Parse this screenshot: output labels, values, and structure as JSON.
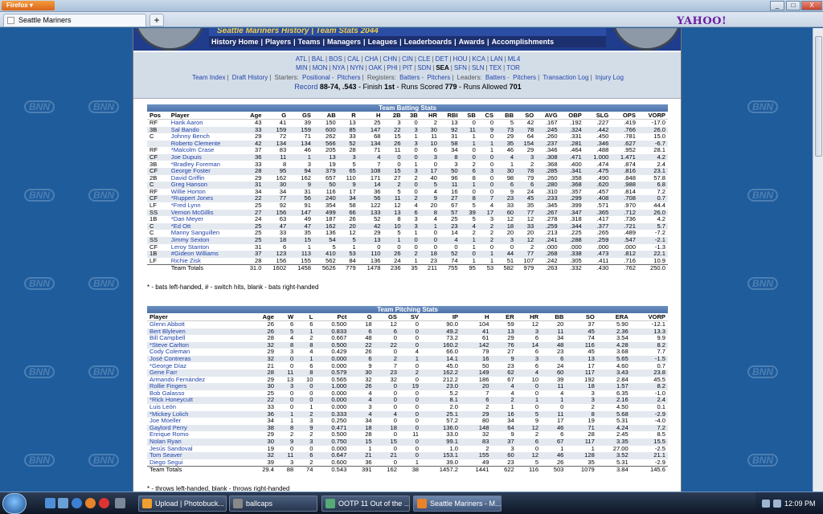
{
  "browser": {
    "app_button": "Firefox",
    "tab_title": "Seattle Mariners",
    "new_tab": "+",
    "search_brand": "YAHOO!",
    "win_min": "_",
    "win_max": "□",
    "win_close": "X"
  },
  "site": {
    "header_banner": "Seattle Mariners History | Team Stats 2044",
    "nav": [
      "History Home",
      "Players",
      "Teams",
      "Managers",
      "Leagues",
      "Leaderboards",
      "Awards",
      "Accomplishments"
    ],
    "bg_logo": "BNN"
  },
  "team_links": {
    "row1": [
      "ATL",
      "BAL",
      "BOS",
      "CAL",
      "CHA",
      "CHN",
      "CIN",
      "CLE",
      "DET",
      "HOU",
      "KCA",
      "LAN",
      "ML4"
    ],
    "row2": [
      "MIN",
      "MON",
      "NYA",
      "NYN",
      "OAK",
      "PHI",
      "PIT",
      "SDN",
      "SEA",
      "SFN",
      "SLN",
      "TEX",
      "TOR"
    ],
    "current": "SEA",
    "row3": {
      "team_index": "Team Index",
      "draft_history": "Draft History",
      "starters_label": "Starters:",
      "starters_positional": "Positional",
      "starters_pitchers": "Pitchers",
      "registers_label": "Registers:",
      "registers_batters": "Batters",
      "registers_pitchers": "Pitchers",
      "leaders_label": "Leaders:",
      "leaders_batters": "Batters",
      "leaders_pitchers": "Pitchers",
      "transaction_log": "Transaction Log",
      "injury_log": "Injury Log"
    },
    "record_label": "Record",
    "record_value": "88-74, .543",
    "finish": " - Finish ",
    "finish_value": "1st",
    "runs_scored_label": " - Runs Scored ",
    "runs_scored": "779",
    "runs_allowed_label": " - Runs Allowed ",
    "runs_allowed": "701"
  },
  "batting": {
    "title": "Team Batting Stats",
    "columns": [
      "Pos",
      "Player",
      "Age",
      "G",
      "GS",
      "AB",
      "R",
      "H",
      "2B",
      "3B",
      "HR",
      "RBI",
      "SB",
      "CS",
      "BB",
      "SO",
      "AVG",
      "OBP",
      "SLG",
      "OPS",
      "VORP"
    ],
    "rows": [
      [
        "RF",
        "Hank Aaron",
        "43",
        "41",
        "39",
        "150",
        "13",
        "25",
        "3",
        "0",
        "2",
        "13",
        "0",
        "0",
        "5",
        "42",
        ".167",
        ".192",
        ".227",
        ".419",
        "-17.0"
      ],
      [
        "3B",
        "Sal Bando",
        "33",
        "159",
        "159",
        "600",
        "85",
        "147",
        "22",
        "3",
        "30",
        "92",
        "11",
        "9",
        "73",
        "78",
        ".245",
        ".324",
        ".442",
        ".766",
        "26.0"
      ],
      [
        "C",
        "Johnny Bench",
        "29",
        "72",
        "71",
        "262",
        "33",
        "68",
        "15",
        "1",
        "11",
        "31",
        "1",
        "0",
        "29",
        "64",
        ".260",
        ".331",
        ".450",
        ".781",
        "15.0"
      ],
      [
        "",
        "Roberto Clemente",
        "42",
        "134",
        "134",
        "566",
        "52",
        "134",
        "26",
        "3",
        "10",
        "58",
        "1",
        "1",
        "35",
        "154",
        ".237",
        ".281",
        ".346",
        ".627",
        "-6.7"
      ],
      [
        "RF",
        "*Malcolm Crase",
        "37",
        "83",
        "46",
        "205",
        "28",
        "71",
        "11",
        "0",
        "6",
        "34",
        "0",
        "1",
        "46",
        "29",
        ".346",
        ".464",
        ".488",
        ".952",
        "28.1"
      ],
      [
        "CF",
        "Joe Dupuis",
        "36",
        "11",
        "1",
        "13",
        "3",
        "4",
        "0",
        "0",
        "3",
        "8",
        "0",
        "0",
        "4",
        "3",
        ".308",
        ".471",
        "1.000",
        "1.471",
        "4.2"
      ],
      [
        "3B",
        "*Bradley Foreman",
        "33",
        "8",
        "3",
        "19",
        "5",
        "7",
        "0",
        "1",
        "0",
        "3",
        "2",
        "0",
        "1",
        "2",
        ".368",
        ".400",
        ".474",
        ".874",
        "2.4"
      ],
      [
        "CF",
        "George Foster",
        "28",
        "95",
        "94",
        "379",
        "65",
        "108",
        "15",
        "3",
        "17",
        "50",
        "6",
        "3",
        "30",
        "78",
        ".285",
        ".341",
        ".475",
        ".816",
        "23.1"
      ],
      [
        "2B",
        "David Griffin",
        "29",
        "162",
        "162",
        "657",
        "110",
        "171",
        "27",
        "2",
        "40",
        "96",
        "8",
        "0",
        "98",
        "79",
        ".260",
        ".358",
        ".490",
        ".848",
        "57.8"
      ],
      [
        "C",
        "Greg Hanson",
        "31",
        "30",
        "9",
        "50",
        "9",
        "14",
        "2",
        "0",
        "5",
        "11",
        "1",
        "0",
        "6",
        "6",
        ".280",
        ".368",
        ".620",
        ".988",
        "6.8"
      ],
      [
        "RF",
        "Willie Horton",
        "34",
        "34",
        "31",
        "116",
        "17",
        "36",
        "5",
        "0",
        "4",
        "16",
        "0",
        "0",
        "9",
        "24",
        ".310",
        ".357",
        ".457",
        ".814",
        "7.2"
      ],
      [
        "CF",
        "*Ruppert Jones",
        "22",
        "77",
        "56",
        "240",
        "34",
        "56",
        "11",
        "2",
        "9",
        "27",
        "8",
        "7",
        "23",
        "45",
        ".233",
        ".299",
        ".408",
        ".708",
        "0.7"
      ],
      [
        "LF",
        "*Fred Lynn",
        "25",
        "92",
        "91",
        "354",
        "58",
        "122",
        "12",
        "4",
        "20",
        "67",
        "5",
        "4",
        "33",
        "35",
        ".345",
        ".399",
        ".571",
        ".970",
        "44.4"
      ],
      [
        "SS",
        "Vernon McGillis",
        "27",
        "156",
        "147",
        "499",
        "66",
        "133",
        "13",
        "6",
        "8",
        "57",
        "39",
        "17",
        "60",
        "77",
        ".267",
        ".347",
        ".365",
        ".712",
        "26.0"
      ],
      [
        "1B",
        "*Dan Meyer",
        "24",
        "63",
        "49",
        "187",
        "26",
        "52",
        "8",
        "3",
        "4",
        "25",
        "5",
        "3",
        "12",
        "12",
        ".278",
        ".318",
        ".417",
        ".736",
        "4.2"
      ],
      [
        "C",
        "*Ed Ott",
        "25",
        "47",
        "47",
        "162",
        "20",
        "42",
        "10",
        "3",
        "1",
        "23",
        "4",
        "2",
        "18",
        "33",
        ".259",
        ".344",
        ".377",
        ".721",
        "5.7"
      ],
      [
        "C",
        "Manny Sanguillen",
        "25",
        "33",
        "35",
        "136",
        "12",
        "29",
        "5",
        "1",
        "0",
        "14",
        "2",
        "2",
        "20",
        "20",
        ".213",
        ".225",
        ".265",
        ".489",
        "-7.2"
      ],
      [
        "SS",
        "Jimmy Sexton",
        "25",
        "18",
        "15",
        "54",
        "5",
        "13",
        "1",
        "0",
        "0",
        "4",
        "1",
        "2",
        "3",
        "12",
        ".241",
        ".288",
        ".259",
        ".547",
        "-2.1"
      ],
      [
        "CF",
        "Leroy Stanton",
        "31",
        "6",
        "1",
        "5",
        "1",
        "0",
        "0",
        "0",
        "0",
        "0",
        "1",
        "0",
        "0",
        "2",
        ".000",
        ".000",
        ".000",
        ".000",
        "-1.3"
      ],
      [
        "1B",
        "#Gideon Williams",
        "37",
        "123",
        "113",
        "410",
        "53",
        "110",
        "26",
        "2",
        "18",
        "52",
        "0",
        "1",
        "44",
        "77",
        ".268",
        ".338",
        ".473",
        ".812",
        "22.1"
      ],
      [
        "LF",
        "Richie Zisk",
        "28",
        "156",
        "155",
        "562",
        "84",
        "136",
        "24",
        "1",
        "23",
        "74",
        "1",
        "1",
        "51",
        "107",
        ".242",
        ".305",
        ".411",
        ".716",
        "10.9"
      ]
    ],
    "totals": [
      "",
      "Team Totals",
      "31.0",
      "1602",
      "1458",
      "5626",
      "779",
      "1478",
      "236",
      "35",
      "211",
      "755",
      "95",
      "53",
      "582",
      "979",
      ".263",
      ".332",
      ".430",
      ".762",
      "250.0"
    ],
    "note": "* - bats left-handed, # - switch hits, blank - bats right-handed"
  },
  "pitching": {
    "title": "Team Pitching Stats",
    "columns": [
      "Player",
      "Age",
      "W",
      "L",
      "Pct",
      "G",
      "GS",
      "SV",
      "IP",
      "H",
      "ER",
      "HR",
      "BB",
      "SO",
      "ERA",
      "VORP"
    ],
    "rows": [
      [
        "Glenn Abbott",
        "26",
        "6",
        "6",
        "0.500",
        "18",
        "12",
        "0",
        "90.0",
        "104",
        "59",
        "12",
        "20",
        "37",
        "5.90",
        "-12.1"
      ],
      [
        "Bert Blyleven",
        "26",
        "5",
        "1",
        "0.833",
        "6",
        "6",
        "0",
        "49.2",
        "41",
        "13",
        "3",
        "11",
        "45",
        "2.36",
        "13.3"
      ],
      [
        "Bill Campbell",
        "28",
        "4",
        "2",
        "0.667",
        "48",
        "0",
        "0",
        "73.2",
        "61",
        "29",
        "6",
        "34",
        "74",
        "3.54",
        "9.9"
      ],
      [
        "*Steve Carlton",
        "32",
        "8",
        "8",
        "0.500",
        "22",
        "22",
        "0",
        "160.2",
        "142",
        "76",
        "14",
        "48",
        "116",
        "4.28",
        "8.2"
      ],
      [
        "Cody Coleman",
        "29",
        "3",
        "4",
        "0.429",
        "26",
        "0",
        "4",
        "66.0",
        "79",
        "27",
        "6",
        "23",
        "45",
        "3.68",
        "7.7"
      ],
      [
        "José Contreras",
        "32",
        "0",
        "1",
        "0.000",
        "6",
        "2",
        "1",
        "14.1",
        "16",
        "9",
        "3",
        "6",
        "13",
        "5.65",
        "-1.5"
      ],
      [
        "*George Díaz",
        "21",
        "0",
        "6",
        "0.000",
        "9",
        "7",
        "0",
        "45.0",
        "50",
        "23",
        "6",
        "24",
        "17",
        "4.60",
        "0.7"
      ],
      [
        "Gene Farr",
        "28",
        "11",
        "8",
        "0.579",
        "30",
        "23",
        "2",
        "162.2",
        "149",
        "62",
        "4",
        "60",
        "117",
        "3.43",
        "23.8"
      ],
      [
        "Armando Fernández",
        "29",
        "13",
        "10",
        "0.565",
        "32",
        "32",
        "0",
        "212.2",
        "186",
        "67",
        "10",
        "39",
        "192",
        "2.84",
        "45.5"
      ],
      [
        "Rollie Fingers",
        "30",
        "3",
        "0",
        "1.000",
        "26",
        "0",
        "19",
        "23.0",
        "20",
        "4",
        "0",
        "11",
        "18",
        "1.57",
        "8.2"
      ],
      [
        "Bob Galasso",
        "25",
        "0",
        "0",
        "0.000",
        "4",
        "0",
        "0",
        "5.2",
        "7",
        "4",
        "0",
        "4",
        "3",
        "6.35",
        "-1.0"
      ],
      [
        "*Rick Honeycutt",
        "22",
        "0",
        "0",
        "0.000",
        "4",
        "0",
        "0",
        "8.1",
        "6",
        "2",
        "1",
        "1",
        "3",
        "2.16",
        "2.4"
      ],
      [
        "Luis León",
        "33",
        "0",
        "1",
        "0.000",
        "3",
        "0",
        "0",
        "2.0",
        "2",
        "1",
        "0",
        "0",
        "2",
        "4.50",
        "0.1"
      ],
      [
        "*Mickey Lolich",
        "36",
        "1",
        "2",
        "0.333",
        "4",
        "4",
        "0",
        "25.1",
        "29",
        "16",
        "5",
        "11",
        "8",
        "5.68",
        "-2.9"
      ],
      [
        "Joe Moeller",
        "34",
        "1",
        "3",
        "0.250",
        "34",
        "0",
        "0",
        "57.2",
        "80",
        "34",
        "9",
        "17",
        "19",
        "5.31",
        "-4.0"
      ],
      [
        "Gaylord Perry",
        "38",
        "8",
        "9",
        "0.471",
        "18",
        "18",
        "0",
        "136.0",
        "148",
        "64",
        "12",
        "46",
        "71",
        "4.24",
        "7.2"
      ],
      [
        "Enrique Romo",
        "29",
        "2",
        "2",
        "0.500",
        "28",
        "0",
        "11",
        "33.0",
        "32",
        "9",
        "2",
        "6",
        "28",
        "2.45",
        "8.5"
      ],
      [
        "Nolan Ryan",
        "30",
        "9",
        "3",
        "0.750",
        "15",
        "15",
        "0",
        "99.1",
        "83",
        "37",
        "6",
        "67",
        "117",
        "3.35",
        "15.5"
      ],
      [
        "Jesús Sandoval",
        "19",
        "0",
        "0",
        "0.000",
        "1",
        "0",
        "0",
        "1.0",
        "2",
        "3",
        "0",
        "1",
        "1",
        "27.00",
        "-2.5"
      ],
      [
        "Tom Seaver",
        "32",
        "11",
        "6",
        "0.647",
        "21",
        "21",
        "0",
        "153.1",
        "155",
        "60",
        "12",
        "46",
        "128",
        "3.52",
        "21.1"
      ],
      [
        "Diego Segui",
        "39",
        "3",
        "2",
        "0.600",
        "36",
        "0",
        "1",
        "39.0",
        "49",
        "23",
        "5",
        "26",
        "35",
        "5.31",
        "-2.9"
      ]
    ],
    "totals": [
      "Team Totals",
      "29.4",
      "88",
      "74",
      "0.543",
      "391",
      "162",
      "38",
      "1457.2",
      "1441",
      "622",
      "116",
      "503",
      "1079",
      "3.84",
      "145.6"
    ],
    "note": "* - throws left-handed, blank - throws right-handed"
  },
  "taskbar": {
    "buttons": [
      "Upload | Photobuck...",
      "ballcaps",
      "OOTP 11 Out of the ...",
      "Seattle Mariners - M..."
    ],
    "clock": "12:09 PM"
  }
}
